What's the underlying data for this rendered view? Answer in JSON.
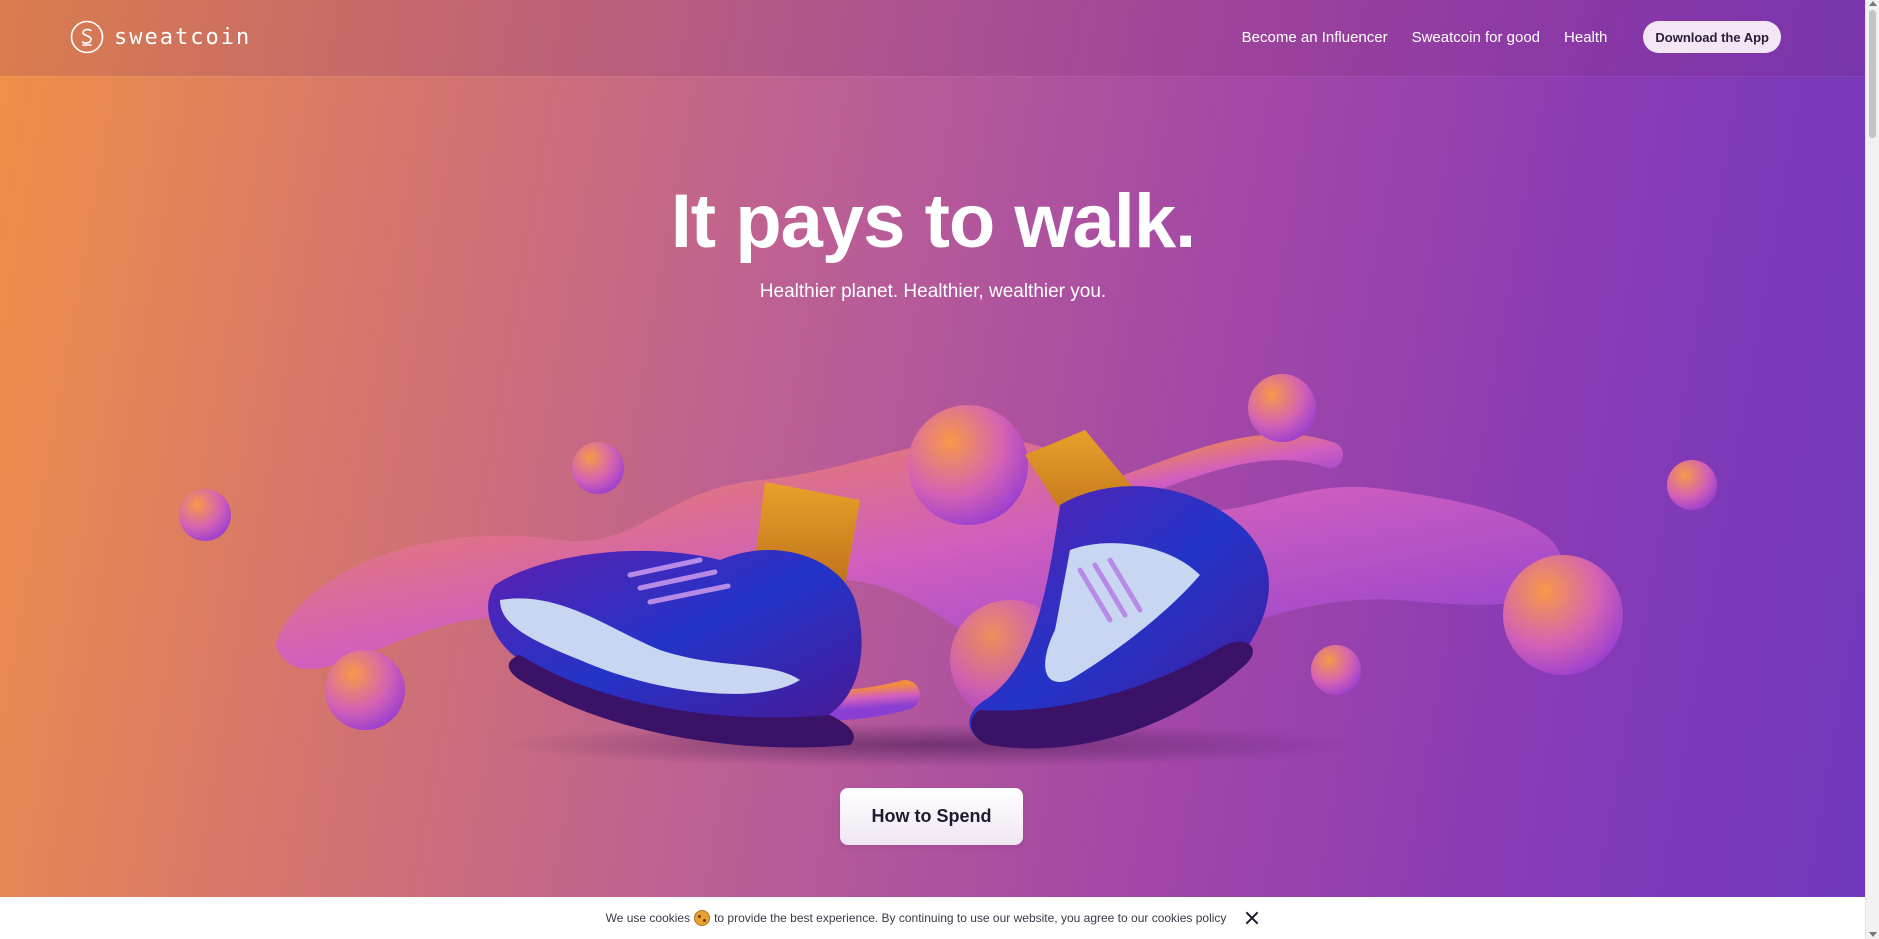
{
  "brand": {
    "name": "sweatcoin"
  },
  "nav": {
    "items": [
      {
        "label": "Become an Influencer"
      },
      {
        "label": "Sweatcoin for good"
      },
      {
        "label": "Health"
      }
    ],
    "download_label": "Download the App"
  },
  "hero": {
    "title": "It pays to walk.",
    "subtitle": "Healthier planet. Healthier, wealthier you.",
    "cta_label": "How to Spend"
  },
  "cookie_banner": {
    "text_before": "We use cookies",
    "text_after": "to provide the best experience. By continuing to use our website, you agree to our cookies policy"
  },
  "colors": {
    "gradient_start": "#ef9147",
    "gradient_mid": "#bc5f95",
    "gradient_end": "#6d38bd",
    "button_bg": "#f3e7f5",
    "button_text": "#2a1d3b"
  },
  "icons": {
    "logo": "sweatcoin-logo-icon",
    "cookie": "cookie-icon",
    "close": "close-icon"
  }
}
